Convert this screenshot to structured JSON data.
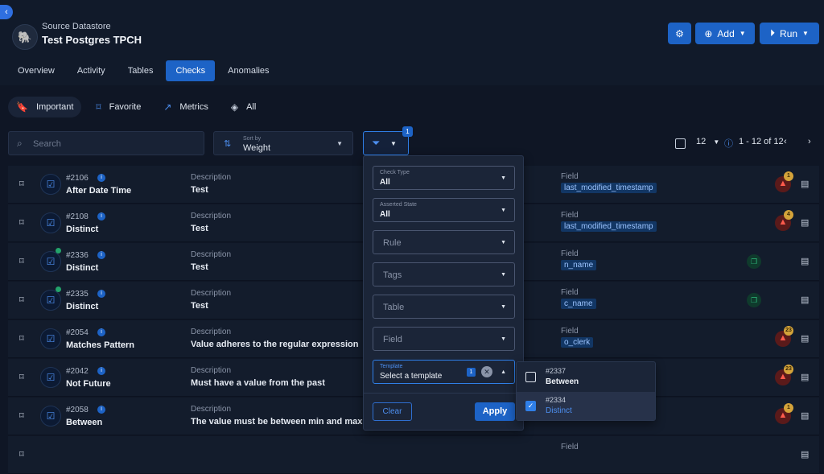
{
  "header": {
    "subtitle": "Source Datastore",
    "title": "Test Postgres TPCH",
    "add_label": "Add",
    "run_label": "Run"
  },
  "tabs": [
    "Overview",
    "Activity",
    "Tables",
    "Checks",
    "Anomalies"
  ],
  "active_tab": "Checks",
  "filter_chips": [
    "Important",
    "Favorite",
    "Metrics",
    "All"
  ],
  "search": {
    "placeholder": "Search"
  },
  "sort": {
    "label": "Sort by",
    "value": "Weight"
  },
  "filter": {
    "badge": "1"
  },
  "pagination": {
    "per_page": "12",
    "range": "1 - 12 of 12"
  },
  "checks": [
    {
      "id": "#2106",
      "name": "After Date Time",
      "desc_label": "Description",
      "description": "Test",
      "field_label": "Field",
      "field": "last_modified_timestamp",
      "warn_count": "1",
      "has_dot": false,
      "has_copy": false
    },
    {
      "id": "#2108",
      "name": "Distinct",
      "desc_label": "Description",
      "description": "Test",
      "field_label": "Field",
      "field": "last_modified_timestamp",
      "warn_count": "4",
      "has_dot": false,
      "has_copy": false
    },
    {
      "id": "#2336",
      "name": "Distinct",
      "desc_label": "Description",
      "description": "Test",
      "field_label": "Field",
      "field": "n_name",
      "warn_count": "",
      "has_dot": true,
      "has_copy": true
    },
    {
      "id": "#2335",
      "name": "Distinct",
      "desc_label": "Description",
      "description": "Test",
      "field_label": "Field",
      "field": "c_name",
      "warn_count": "",
      "has_dot": true,
      "has_copy": true
    },
    {
      "id": "#2054",
      "name": "Matches Pattern",
      "desc_label": "Description",
      "description": "Value adheres to the regular expression",
      "field_label": "Field",
      "field": "o_clerk",
      "warn_count": "23",
      "has_dot": false,
      "has_copy": false
    },
    {
      "id": "#2042",
      "name": "Not Future",
      "desc_label": "Description",
      "description": "Must have a value from the past",
      "field_label": "Field",
      "field": "",
      "warn_count": "23",
      "has_dot": false,
      "has_copy": false
    },
    {
      "id": "#2058",
      "name": "Between",
      "desc_label": "Description",
      "description": "The value must be between min and max inclu",
      "field_label": "Field",
      "field": "",
      "warn_count": "1",
      "has_dot": false,
      "has_copy": false
    },
    {
      "id": "",
      "name": "",
      "desc_label": "",
      "description": "",
      "field_label": "Field",
      "field": "",
      "warn_count": "",
      "has_dot": false,
      "has_copy": false
    }
  ],
  "filter_panel": {
    "check_type": {
      "label": "Check Type",
      "value": "All"
    },
    "asserted_state": {
      "label": "Asserted State",
      "value": "All"
    },
    "rule": "Rule",
    "tags": "Tags",
    "table": "Table",
    "field": "Field",
    "template": {
      "label": "Template",
      "placeholder": "Select a template",
      "count": "1"
    },
    "clear_label": "Clear",
    "apply_label": "Apply"
  },
  "template_options": [
    {
      "id": "#2337",
      "name": "Between",
      "checked": false
    },
    {
      "id": "#2334",
      "name": "Distinct",
      "checked": true
    }
  ],
  "colors": {
    "accent": "#1d63c6",
    "background": "#0f1625",
    "warning": "#ff5b4d"
  }
}
